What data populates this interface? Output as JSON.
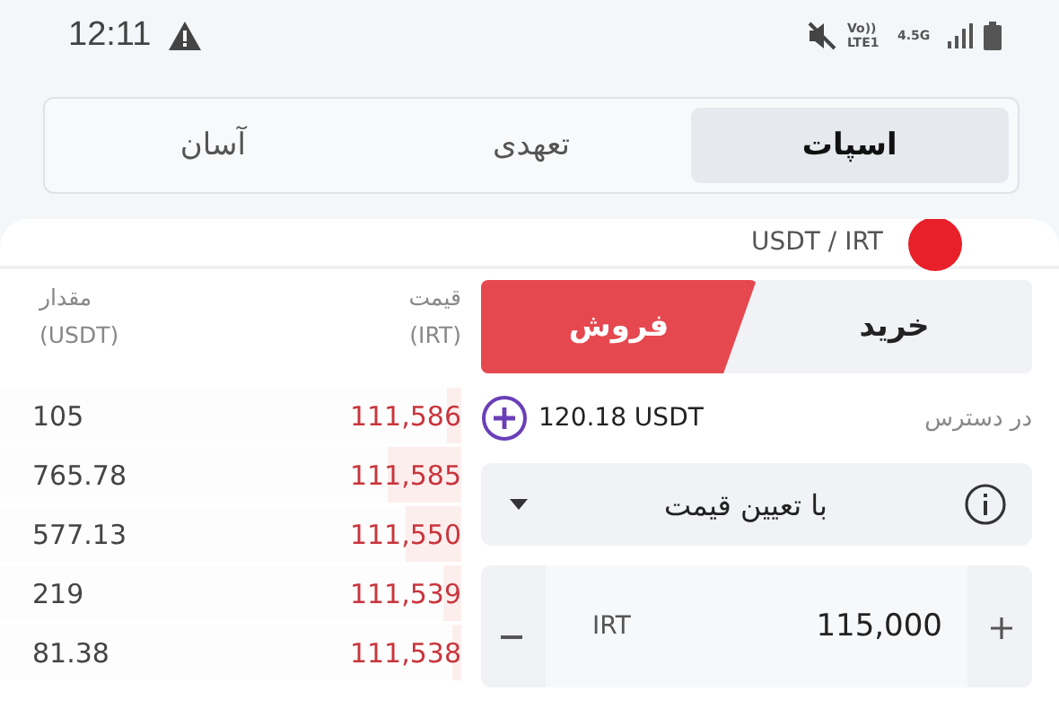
{
  "status_bar": {
    "time": "12:11",
    "network_label": "Vo)) LTE1",
    "data_label": "4.5G"
  },
  "tabs": [
    {
      "label": "اسپات",
      "selected": true
    },
    {
      "label": "تعهدی",
      "selected": false
    },
    {
      "label": "آسان",
      "selected": false
    }
  ],
  "pair": {
    "label": "USDT / IRT"
  },
  "order_book": {
    "columns": [
      {
        "title": "قیمت",
        "unit": "(IRT)"
      },
      {
        "title": "مقدار",
        "unit": "(USDT)"
      }
    ],
    "rows": [
      {
        "price": "111,586",
        "amount": "105",
        "level": 0.03
      },
      {
        "price": "111,585",
        "amount": "765.78",
        "level": 0.16
      },
      {
        "price": "111,550",
        "amount": "577.13",
        "level": 0.12
      },
      {
        "price": "111,539",
        "amount": "219",
        "level": 0.04
      },
      {
        "price": "111,538",
        "amount": "81.38",
        "level": 0.02
      }
    ]
  },
  "order_form": {
    "sides": [
      {
        "label": "خرید",
        "selected": false
      },
      {
        "label": "فروش",
        "selected": true
      }
    ],
    "available_label": "در دسترس",
    "available_value": "120.18 USDT",
    "order_type": "با تعیین قیمت",
    "price": {
      "unit": "IRT",
      "value": "115,000"
    }
  }
}
